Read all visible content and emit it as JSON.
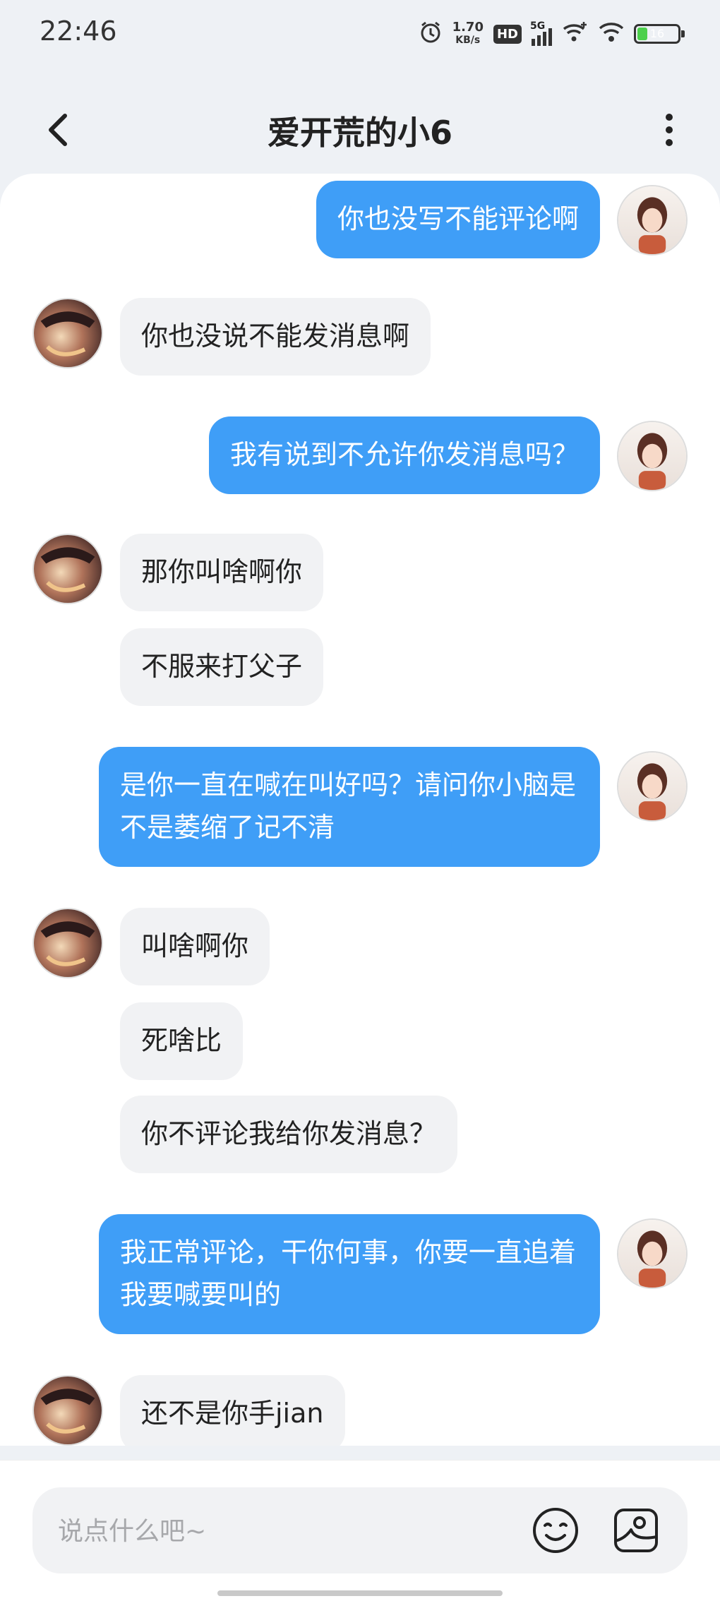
{
  "status_bar": {
    "time": "22:46",
    "net_speed_value": "1.70",
    "net_speed_unit": "KB/s",
    "hd_label": "HD",
    "network_label": "5G",
    "battery_level": "16",
    "icons": [
      "alarm-icon",
      "signal-icon",
      "wifi-plus-icon",
      "wifi-icon",
      "battery-icon"
    ]
  },
  "header": {
    "title": "爱开荒的小6",
    "back_icon": "chevron-left-icon",
    "more_icon": "more-vertical-icon"
  },
  "messages": [
    {
      "side": "out",
      "text": "你也没写不能评论啊"
    },
    {
      "side": "in",
      "text": "你也没说不能发消息啊"
    },
    {
      "side": "out",
      "text": "我有说到不允许你发消息吗？"
    },
    {
      "side": "in",
      "text": "那你叫啥啊你"
    },
    {
      "side": "in",
      "text": "不服来打父子"
    },
    {
      "side": "out",
      "text": "是你一直在喊在叫好吗？请问你小脑是不是萎缩了记不清"
    },
    {
      "side": "in",
      "text": "叫啥啊你"
    },
    {
      "side": "in",
      "text": "死啥比"
    },
    {
      "side": "in",
      "text": "你不评论我给你发消息？"
    },
    {
      "side": "out",
      "text": "我正常评论，干你何事，你要一直追着我要喊要叫的"
    },
    {
      "side": "in",
      "text": "还不是你手jian"
    }
  ],
  "input": {
    "placeholder": "说点什么吧~",
    "emoji_icon": "smile-face-icon",
    "sticker_icon": "sticker-icon"
  },
  "colors": {
    "outgoing_bubble": "#3f9ef7",
    "incoming_bubble": "#f1f2f4",
    "background": "#eef1f5"
  }
}
